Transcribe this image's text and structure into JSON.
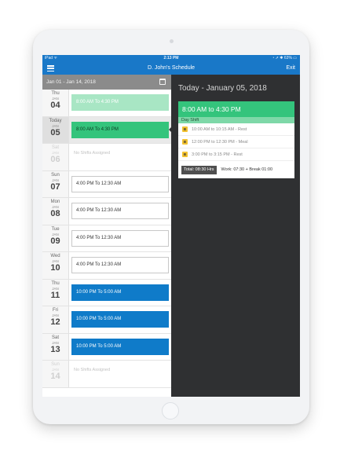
{
  "status_bar": {
    "carrier": "iPad ᯤ",
    "time": "2:13 PM",
    "right": "◔ ➚ ✱ 63% ▭"
  },
  "nav": {
    "title": "D. John's Schedule",
    "exit_label": "Exit"
  },
  "range_bar": {
    "label": "Jan 01 - Jan 14, 2018"
  },
  "days": [
    {
      "dow": "Thu",
      "mon": "JAN",
      "day": "04",
      "shift": "8:00 AM To 4:30 PM",
      "style": "mint"
    },
    {
      "dow": "Today",
      "mon": "JAN",
      "day": "05",
      "shift": "8:00 AM To 4:30 PM",
      "style": "green",
      "selected": true
    },
    {
      "dow": "Sat",
      "mon": "JAN",
      "day": "06",
      "none": "No Shifts Assigned",
      "faded": true
    },
    {
      "dow": "Sun",
      "mon": "JAN",
      "day": "07",
      "shift": "4:00 PM To 12:30 AM",
      "style": "white"
    },
    {
      "dow": "Mon",
      "mon": "JAN",
      "day": "08",
      "shift": "4:00 PM To 12:30 AM",
      "style": "white"
    },
    {
      "dow": "Tue",
      "mon": "JAN",
      "day": "09",
      "shift": "4:00 PM To 12:30 AM",
      "style": "white"
    },
    {
      "dow": "Wed",
      "mon": "JAN",
      "day": "10",
      "shift": "4:00 PM To 12:30 AM",
      "style": "white"
    },
    {
      "dow": "Thu",
      "mon": "JAN",
      "day": "11",
      "shift": "10:00 PM To 5:00 AM",
      "style": "blue"
    },
    {
      "dow": "Fri",
      "mon": "JAN",
      "day": "12",
      "shift": "10:00 PM To 5:00 AM",
      "style": "blue"
    },
    {
      "dow": "Sat",
      "mon": "JAN",
      "day": "13",
      "shift": "10:00 PM To 5:00 AM",
      "style": "blue"
    },
    {
      "dow": "Sun",
      "mon": "JAN",
      "day": "14",
      "none": "No Shifts Assigned",
      "faded": true
    }
  ],
  "detail": {
    "title": "Today - January 05, 2018",
    "shift_time": "8:00 AM to 4:30 PM",
    "shift_name": "Day Shift",
    "breaks": [
      {
        "badge": "B",
        "text": "10:00 AM to 10:15 AM - Rest"
      },
      {
        "badge": "B",
        "text": "12:00 PM to 12:30 PM - Meal"
      },
      {
        "badge": "B",
        "text": "3:00 PM to 3:15 PM - Rest"
      }
    ],
    "total": "Total: 08:30 Hrs",
    "work_summary": "Work: 07:30 + Break 01:00"
  },
  "colors": {
    "nav_blue": "#1978c8",
    "shift_green": "#34c47c",
    "shift_mint": "#a8e6c4",
    "shift_blue": "#0f7bc9",
    "break_badge": "#f2c230",
    "detail_bg": "#2f3032"
  },
  "icons": {
    "menu": "hamburger-menu-icon",
    "calendar": "calendar-icon"
  }
}
